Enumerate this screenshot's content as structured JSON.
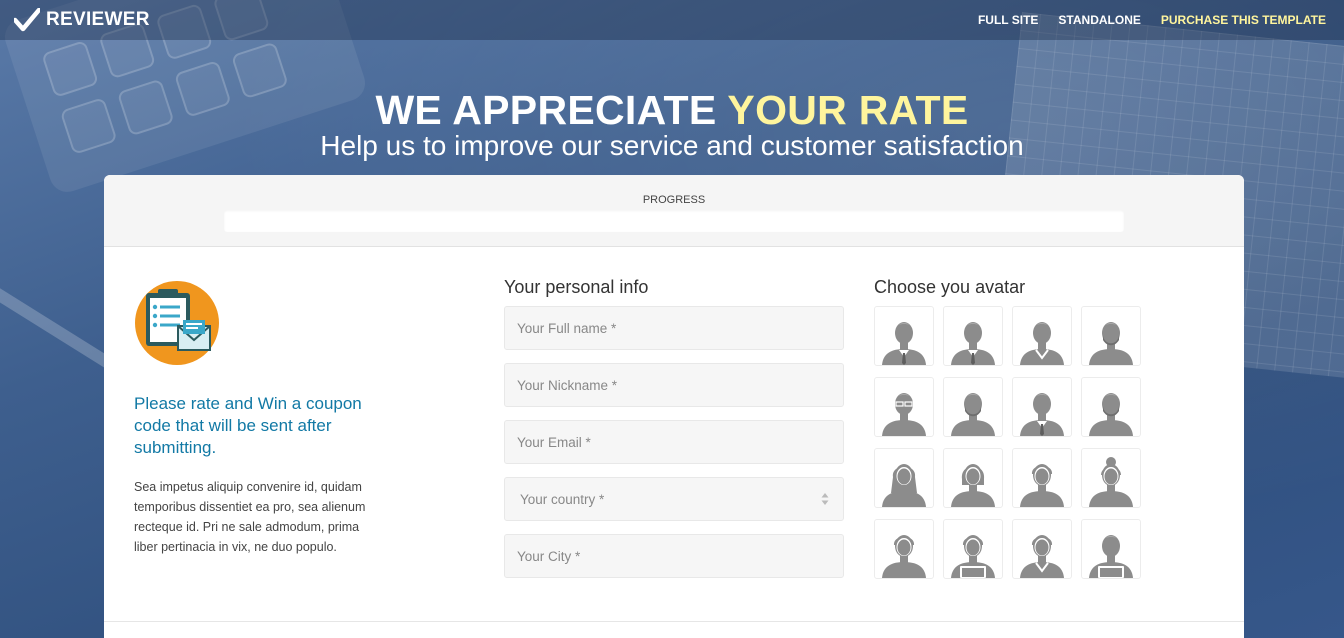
{
  "brand": {
    "name": "REVIEWER"
  },
  "nav": {
    "full_site": "FULL SITE",
    "standalone": "STANDALONE",
    "purchase": "PURCHASE THIS TEMPLATE"
  },
  "hero": {
    "title_main": "WE APPRECIATE ",
    "title_accent": "YOUR RATE",
    "subtitle": "Help us to improve our service and customer satisfaction"
  },
  "progress": {
    "label": "PROGRESS",
    "percent": 0
  },
  "intro": {
    "promo": "Please rate and Win a coupon code that will be sent after submitting.",
    "description": "Sea impetus aliquip convenire id, quidam temporibus dissentiet ea pro, sea alienum recteque id. Pri ne sale admodum, prima liber pertinacia in vix, ne duo populo."
  },
  "personal": {
    "title": "Your personal info",
    "full_name_placeholder": "Your Full name *",
    "nickname_placeholder": "Your Nickname *",
    "email_placeholder": "Your Email *",
    "country_selected": "Your country *",
    "city_placeholder": "Your City *"
  },
  "avatars": {
    "title": "Choose you avatar",
    "items": [
      "male-suit-icon",
      "male-tie-icon",
      "male-shirt-icon",
      "male-beard-icon",
      "male-glasses-icon",
      "male-bearded-icon",
      "male-business-icon",
      "male-bald-beard-icon",
      "female-long-hair-icon",
      "female-bob-icon",
      "female-straight-icon",
      "female-bun-icon",
      "female-short-icon",
      "female-laptop-icon",
      "female-vneck-icon",
      "male-laptop-icon"
    ]
  },
  "colors": {
    "accent_yellow": "#fff59d",
    "promo_blue": "#1279a5",
    "avatar_gray": "#8c8c8c",
    "badge_orange": "#f0961e"
  }
}
